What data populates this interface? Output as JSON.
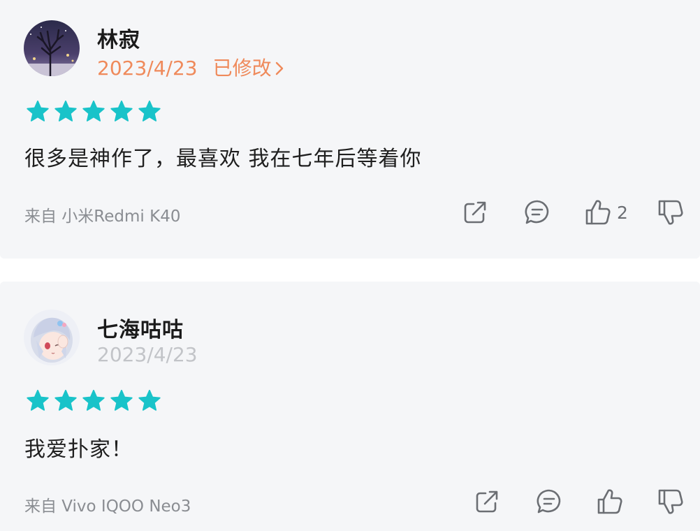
{
  "reviews": [
    {
      "username": "林寂",
      "date": "2023/4/23",
      "edited_label": "已修改",
      "rating": 5,
      "text": "很多是神作了，最喜欢 我在七年后等着你",
      "source": "来自 小米Redmi K40",
      "like_count": "2",
      "avatar_icon": "winter-tree-night-avatar"
    },
    {
      "username": "七海咕咕",
      "date": "2023/4/23",
      "rating": 5,
      "text": "我爱扑家！",
      "source": "来自 Vivo IQOO Neo3",
      "avatar_icon": "anime-girl-avatar"
    }
  ],
  "colors": {
    "star": "#19c3c9",
    "edited": "#ef8a5b",
    "date_muted": "#c2c4c8",
    "icon": "#6b6e73",
    "card_bg": "#f5f6f8"
  },
  "icons": {
    "share": "share-icon",
    "comment": "comment-icon",
    "like": "thumbs-up-icon",
    "dislike": "thumbs-down-icon",
    "star": "star-icon",
    "chevron": "chevron-right-icon"
  }
}
